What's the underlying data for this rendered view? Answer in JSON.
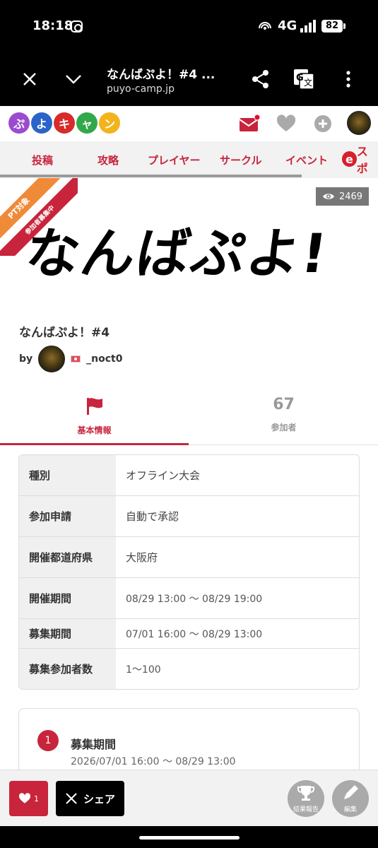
{
  "status_bar": {
    "time": "18:18",
    "network": "4G",
    "battery": "82"
  },
  "browser": {
    "page_title": "なんばぷよ！#4 ...",
    "domain": "puyo-camp.jp"
  },
  "site": {
    "logo_chars": [
      "ぷ",
      "よ",
      "キ",
      "ャ",
      "ン"
    ],
    "logo_colors": [
      "#9b4bd0",
      "#2a63c9",
      "#d82a2a",
      "#32a84a",
      "#f2b31c"
    ]
  },
  "nav": {
    "items": [
      "投稿",
      "攻略",
      "プレイヤー",
      "サークル",
      "イベント"
    ],
    "esports_label": "スポ"
  },
  "banner": {
    "ribbon_main": "PT対象",
    "ribbon_sub": "参加者募集中",
    "views": "2469",
    "big_title": "なんばぷよ!"
  },
  "event": {
    "title": "なんばぷよ！#4",
    "by_label": "by",
    "organizer": "_noct0"
  },
  "tabs": {
    "info_label": "基本情報",
    "participants_count": "67",
    "participants_label": "参加者"
  },
  "info": {
    "rows": [
      {
        "key": "種別",
        "value": "オフライン大会"
      },
      {
        "key": "参加申請",
        "value": "自動で承認"
      },
      {
        "key": "開催都道府県",
        "value": "大阪府"
      },
      {
        "key": "開催期間",
        "value": "08/29 13:00 〜 08/29 19:00"
      },
      {
        "key": "募集期間",
        "value": "07/01 16:00 〜 08/29 13:00"
      },
      {
        "key": "募集参加者数",
        "value": "1〜100"
      }
    ]
  },
  "schedule": {
    "number": "1",
    "title": "募集期間",
    "date": "2026/07/01 16:00 〜 08/29 13:00"
  },
  "actions": {
    "like_count": "1",
    "share_label": "シェア",
    "report_label": "結果報告",
    "edit_label": "編集"
  },
  "colors": {
    "brand_red": "#c8243c",
    "ribbon_orange": "#ef8a39"
  }
}
